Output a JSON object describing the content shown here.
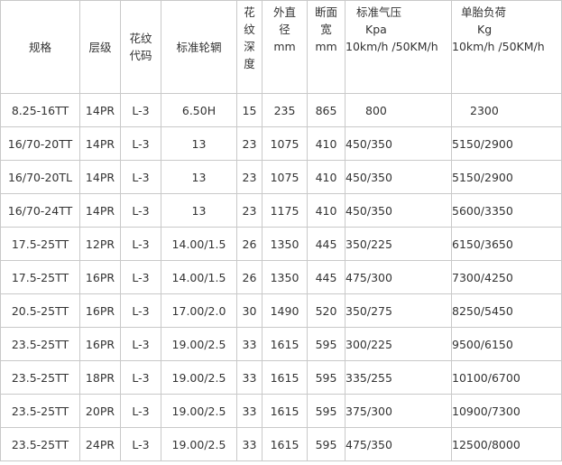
{
  "header": {
    "spec": "规格",
    "ply": "层级",
    "pattern_code": [
      "花纹",
      "代码"
    ],
    "rim": "标准轮辋",
    "tread_depth": [
      "花",
      "纹",
      "深",
      "度"
    ],
    "outer_diameter": [
      "外直",
      "径",
      "mm"
    ],
    "section_width": [
      "断面",
      "宽",
      "mm"
    ],
    "pressure": [
      "标准气压",
      "Kpa",
      "10km/h /50KM/h"
    ],
    "load": [
      "单胎负荷",
      "Kg",
      "10km/h /50KM/h"
    ]
  },
  "rows": [
    [
      "8.25-16TT",
      "14PR",
      "L-3",
      "6.50H",
      "15",
      "235",
      "865",
      "800",
      "2300"
    ],
    [
      "16/70-20TT",
      "14PR",
      "L-3",
      "13",
      "23",
      "1075",
      "410",
      "450/350",
      "5150/2900"
    ],
    [
      "16/70-20TL",
      "14PR",
      "L-3",
      "13",
      "23",
      "1075",
      "410",
      "450/350",
      "5150/2900"
    ],
    [
      "16/70-24TT",
      "14PR",
      "L-3",
      "13",
      "23",
      "1175",
      "410",
      "450/350",
      "5600/3350"
    ],
    [
      "17.5-25TT",
      "12PR",
      "L-3",
      "14.00/1.5",
      "26",
      "1350",
      "445",
      "350/225",
      "6150/3650"
    ],
    [
      "17.5-25TT",
      "16PR",
      "L-3",
      "14.00/1.5",
      "26",
      "1350",
      "445",
      "475/300",
      "7300/4250"
    ],
    [
      "20.5-25TT",
      "16PR",
      "L-3",
      "17.00/2.0",
      "30",
      "1490",
      "520",
      "350/275",
      "8250/5450"
    ],
    [
      "23.5-25TT",
      "16PR",
      "L-3",
      "19.00/2.5",
      "33",
      "1615",
      "595",
      "300/225",
      "9500/6150"
    ],
    [
      "23.5-25TT",
      "18PR",
      "L-3",
      "19.00/2.5",
      "33",
      "1615",
      "595",
      "335/255",
      "10100/6700"
    ],
    [
      "23.5-25TT",
      "20PR",
      "L-3",
      "19.00/2.5",
      "33",
      "1615",
      "595",
      "375/300",
      "10900/7300"
    ],
    [
      "23.5-25TT",
      "24PR",
      "L-3",
      "19.00/2.5",
      "33",
      "1615",
      "595",
      "475/350",
      "12500/8000"
    ]
  ]
}
